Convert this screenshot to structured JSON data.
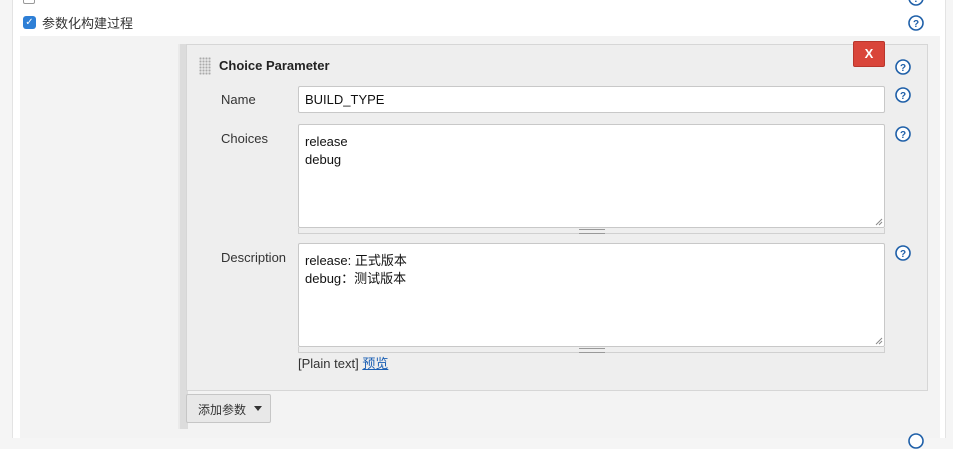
{
  "section": {
    "checkbox_label": "参数化构建过程",
    "checkbox_checked": true
  },
  "param": {
    "title": "Choice Parameter",
    "delete_label": "X",
    "name_label": "Name",
    "name_value": "BUILD_TYPE",
    "choices_label": "Choices",
    "choices_value": "release\ndebug",
    "description_label": "Description",
    "description_value": "release: 正式版本\ndebug：测试版本",
    "format_text": "[Plain text]",
    "preview_link": "预览"
  },
  "add_button": {
    "label": "添加参数"
  },
  "colors": {
    "accent_checkbox": "#2e7fd6",
    "delete_red": "#d9453a",
    "help_blue": "#1e5fa8",
    "link_blue": "#1a5fb4"
  },
  "icons": [
    "help-icon",
    "drag-handle-icon",
    "caret-down-icon",
    "resize-handle-icon"
  ]
}
